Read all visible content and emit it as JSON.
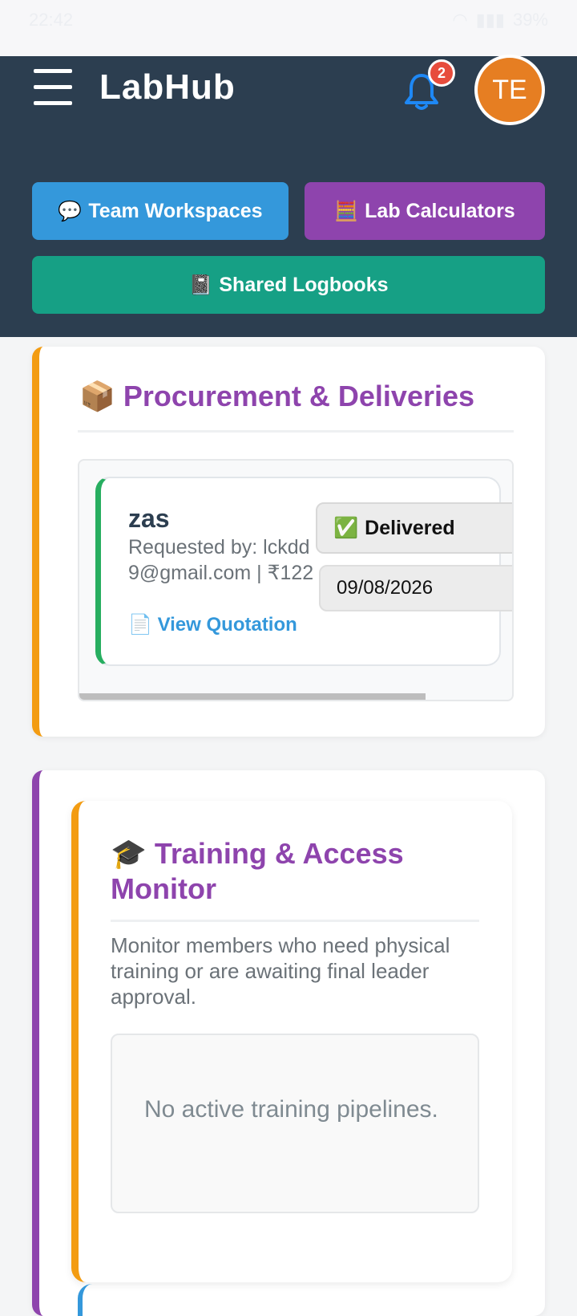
{
  "status_bar": {
    "time": "22:42",
    "battery": "39%"
  },
  "header": {
    "brand": "LabHub",
    "notification_count": "2",
    "avatar_initials": "TE",
    "nav": {
      "team_workspaces": "Team Workspaces",
      "lab_calculators": "Lab Calculators",
      "shared_logbooks": "Shared Logbooks"
    },
    "nav_icons": {
      "team_workspaces": "💬",
      "lab_calculators": "🧮",
      "shared_logbooks": "📓"
    }
  },
  "procurement": {
    "icon": "📦",
    "title": "Procurement & Deliveries",
    "items": [
      {
        "name": "zas",
        "meta": "Requested by: lckdd9@gmail.com | ₹122",
        "link_icon": "📄",
        "link_label": "View Quotation",
        "status_icon": "✅",
        "status": "Delivered",
        "date": "09/08/2026"
      }
    ]
  },
  "training": {
    "icon": "🎓",
    "title": "Training & Access Monitor",
    "description": "Monitor members who need physical training or are awaiting final leader approval.",
    "empty_message": "No active training pipelines."
  },
  "colors": {
    "header_bg": "#2c3e50",
    "accent_purple": "#8e44ad",
    "accent_blue": "#3498db",
    "accent_teal": "#16a085",
    "accent_orange": "#f39c12",
    "status_green": "#27ae60",
    "badge_red": "#e74c3c",
    "avatar_orange": "#e67e22"
  }
}
